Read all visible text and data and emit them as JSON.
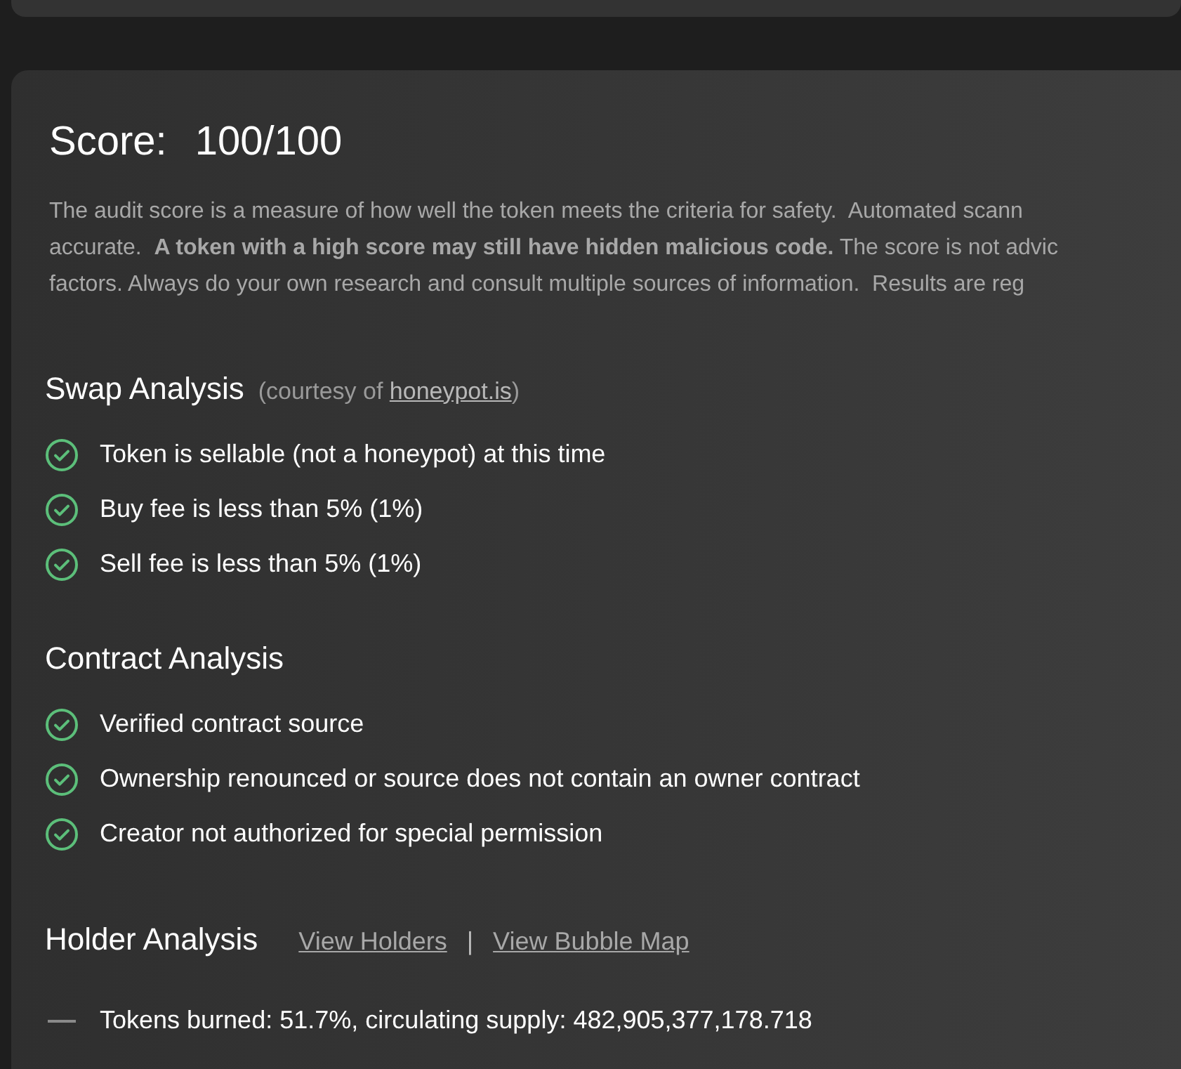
{
  "score": {
    "label": "Score:",
    "value": "100/100"
  },
  "description_lines": [
    "The audit score is a measure of how well the token meets the criteria for safety.  Automated scann",
    "accurate.  **A token with a high score may still have hidden malicious code.** The score is not advic",
    "factors. Always do your own research and consult multiple sources of information.  Results are reg"
  ],
  "sections": [
    {
      "title": "Swap Analysis",
      "note_prefix": "(courtesy of ",
      "note_link": "honeypot.is",
      "note_suffix": ")",
      "items": [
        {
          "kind": "pass",
          "text": "Token is sellable (not a honeypot) at this time"
        },
        {
          "kind": "pass",
          "text": "Buy fee is less than 5% (1%)"
        },
        {
          "kind": "pass",
          "text": "Sell fee is less than 5% (1%)"
        }
      ]
    },
    {
      "title": "Contract Analysis",
      "items": [
        {
          "kind": "pass",
          "text": "Verified contract source"
        },
        {
          "kind": "pass",
          "text": "Ownership renounced or source does not contain an owner contract"
        },
        {
          "kind": "pass",
          "text": "Creator not authorized for special permission"
        }
      ]
    },
    {
      "title": "Holder Analysis",
      "links": [
        "View Holders",
        "View Bubble Map"
      ],
      "separator": "|",
      "items": [
        {
          "kind": "neutral",
          "text": "Tokens burned: 51.7%, circulating supply: 482,905,377,178.718"
        }
      ]
    }
  ]
}
